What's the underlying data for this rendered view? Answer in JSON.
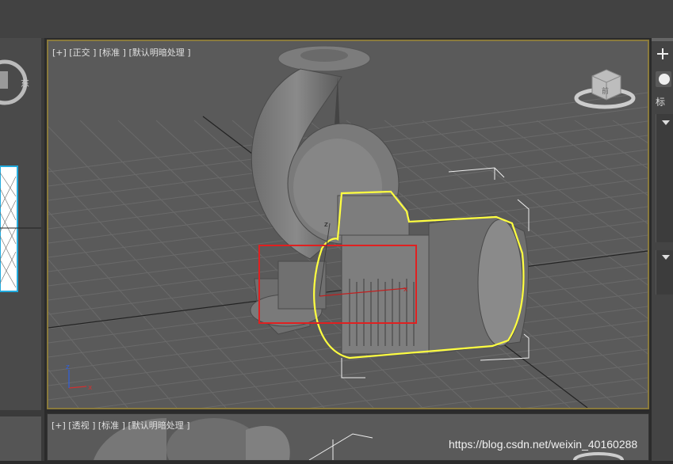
{
  "viewports": {
    "main": {
      "label": "[+] [正交 ] [标准 ] [默认明暗处理 ]"
    },
    "bottom": {
      "label": "[+] [透视 ] [标准 ] [默认明暗处理 ]"
    }
  },
  "viewcube": {
    "face_label": "前"
  },
  "left_panel": {
    "viewcube_label": "东"
  },
  "right_panel": {
    "add_icon": "plus-icon",
    "tab_label": "标"
  },
  "watermark": "https://blog.csdn.net/weixin_40160288",
  "colors": {
    "selection": "#ffff40",
    "highlight_box": "#e02020",
    "active_border": "#8a7a3c",
    "viewport_bg": "#5a5a5a"
  }
}
